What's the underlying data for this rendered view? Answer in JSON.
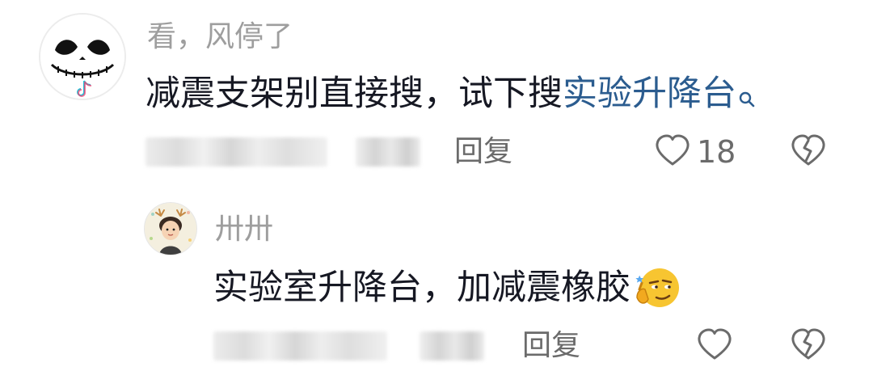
{
  "comment": {
    "username": "看，风停了",
    "text_plain": "减震支架别直接搜，试下搜",
    "search_link_text": "实验升降台",
    "reply_label": "回复",
    "like_count": "18"
  },
  "reply": {
    "username": "卅卅",
    "text": "实验室升降台，加减震橡胶",
    "reply_label": "回复"
  },
  "colors": {
    "username": "#9e9e9e",
    "body_text": "#161823",
    "search_link": "#2b5c8f",
    "meta_text": "#6b6b6b",
    "icon_stroke": "#6b6b6b"
  },
  "icons": {
    "search_link_suffix": "search-icon",
    "like": "heart-outline-icon",
    "dislike": "broken-heart-icon",
    "reply_emoji": "smirk-emoji-icon"
  }
}
